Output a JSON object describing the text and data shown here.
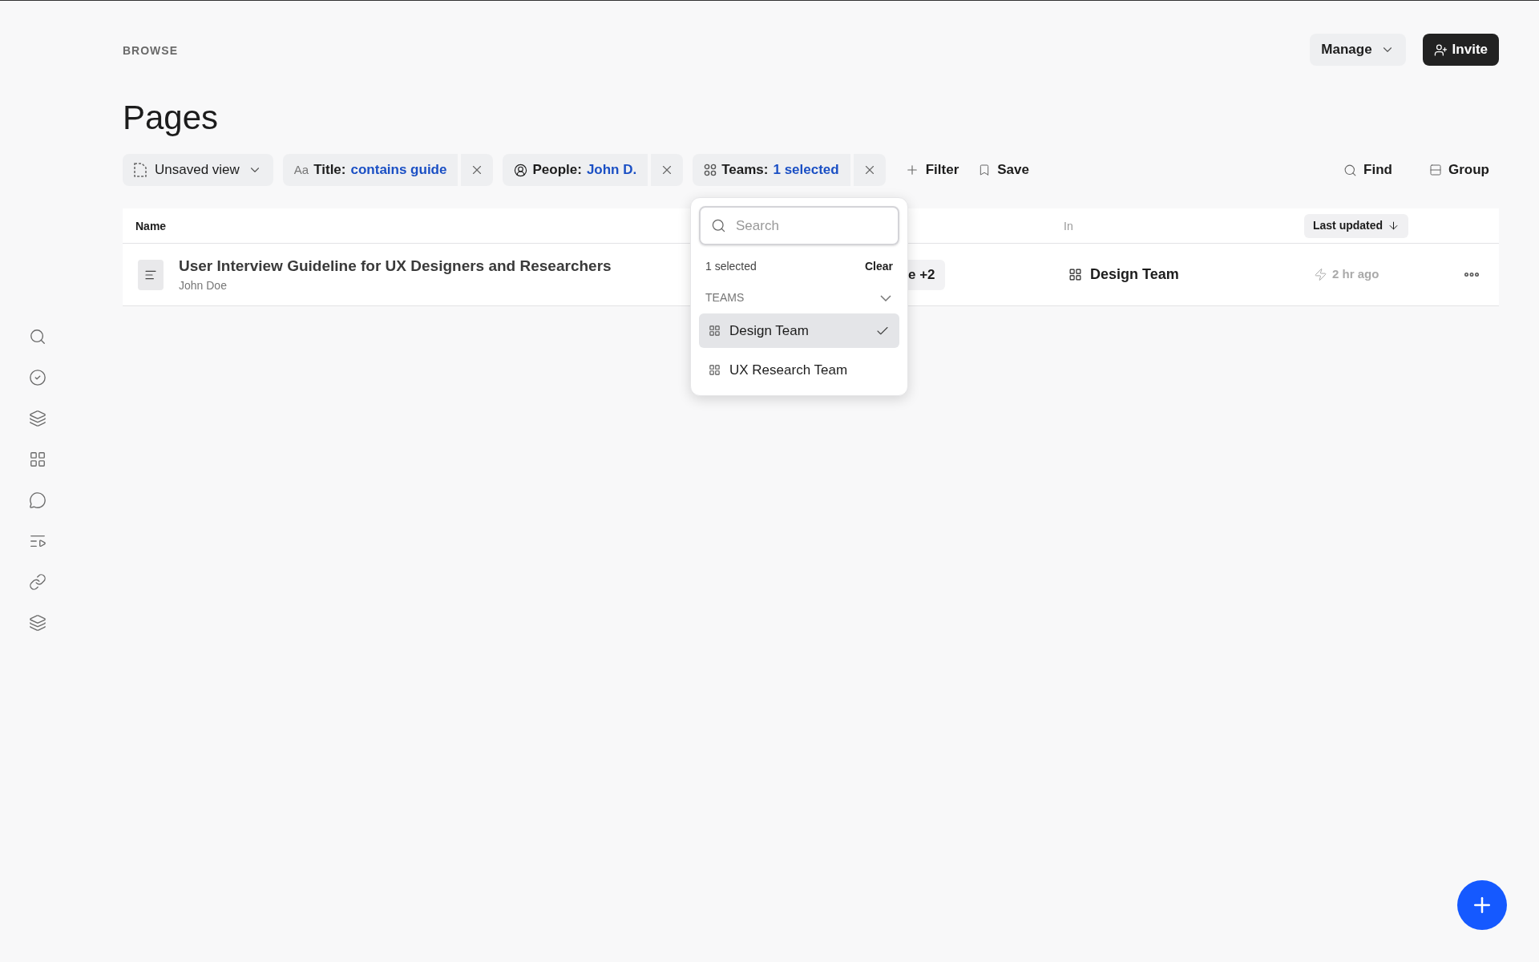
{
  "header": {
    "breadcrumb": "BROWSE",
    "title": "Pages",
    "buttons": [
      {
        "kind": "menu",
        "label": "Manage"
      },
      {
        "kind": "primary",
        "label": "Invite"
      }
    ]
  },
  "filters": [
    {
      "kind": "view",
      "label": "Unsaved view"
    },
    {
      "kind": "text",
      "prefix": "Aa",
      "label": "Title:",
      "value": "contains guide"
    },
    {
      "kind": "person",
      "label": "People:",
      "value": "John D."
    },
    {
      "kind": "team",
      "label": "Teams:",
      "value": "1 selected"
    }
  ],
  "actions": [
    {
      "kind": "add",
      "label": "Filter"
    },
    {
      "kind": "save",
      "label": "Save"
    }
  ],
  "tools": [
    {
      "kind": "find",
      "label": "Find"
    },
    {
      "kind": "group",
      "label": "Group"
    }
  ],
  "table": {
    "columns": [
      {
        "label": "Name"
      },
      {
        "label": "In"
      },
      {
        "label": "Last updated",
        "sorted": true
      }
    ],
    "rows": [
      {
        "title": "User Interview Guideline for UX Designers and Researchers",
        "author": "John Doe",
        "column_2": "e +2",
        "in": "Design Team",
        "updated": "2 hr ago"
      }
    ]
  },
  "dropdown": {
    "placeholder": "Search",
    "count": "1 selected",
    "clear": "Clear",
    "section": "TEAMS",
    "expanded": true,
    "options": [
      {
        "label": "Design Team",
        "selected": true
      },
      {
        "label": "UX Research Team",
        "selected": false
      }
    ]
  }
}
